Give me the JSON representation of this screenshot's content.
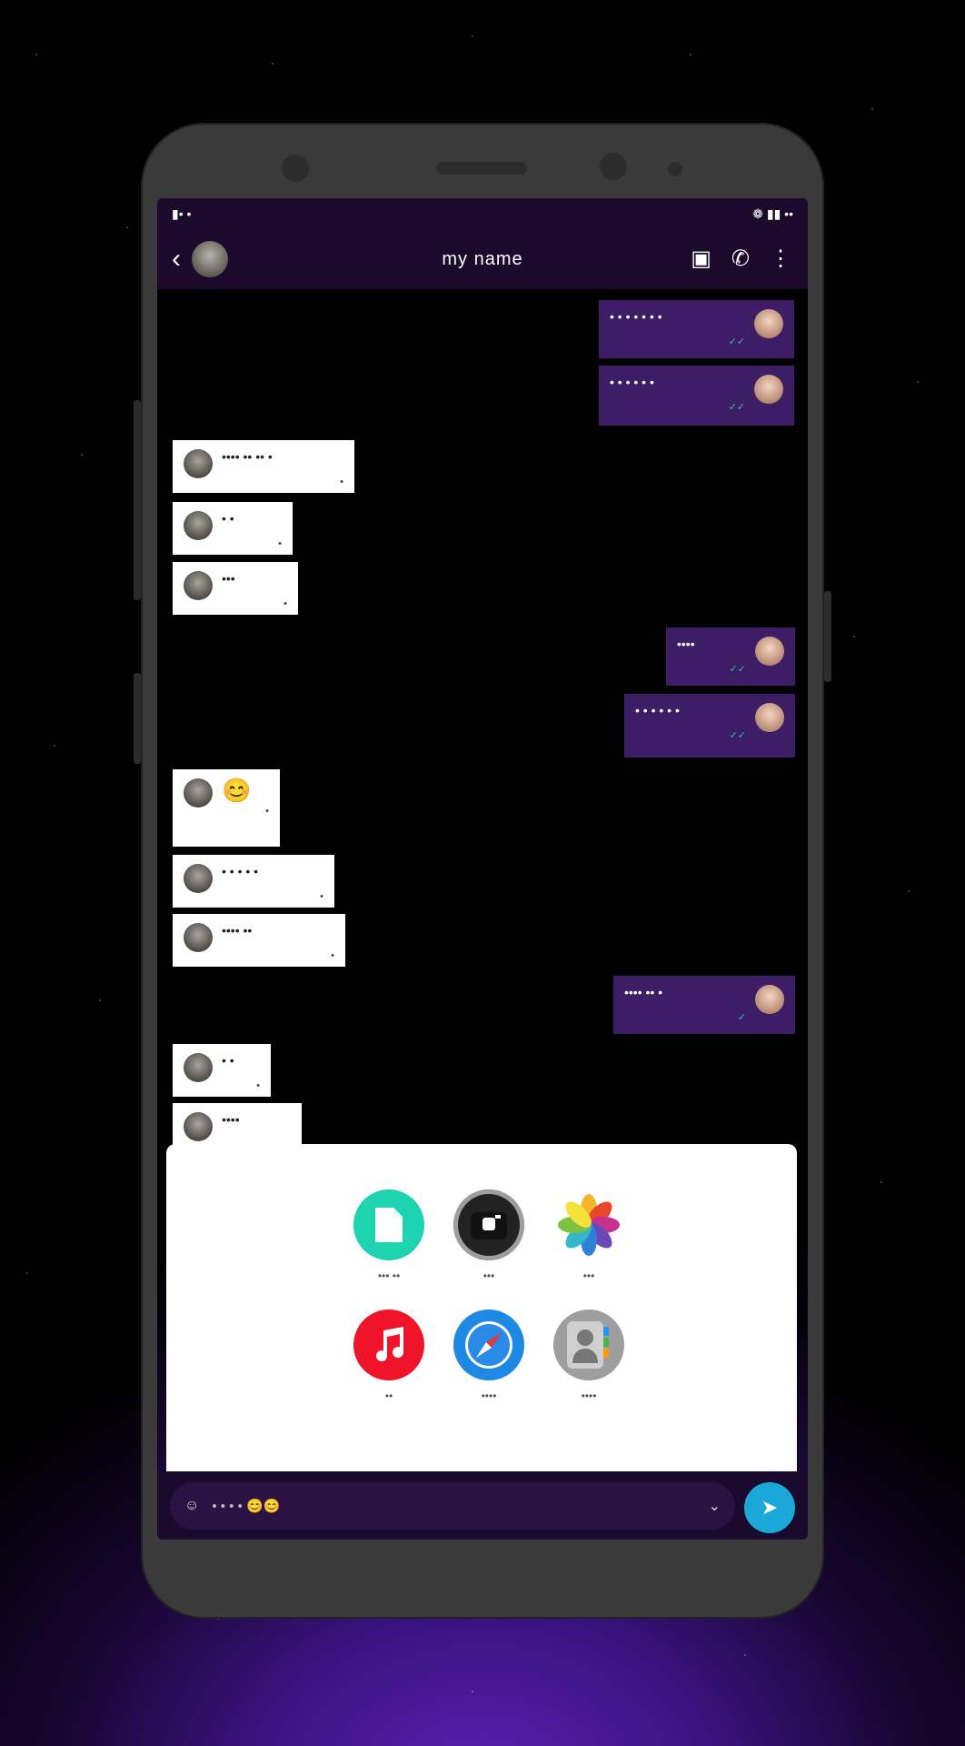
{
  "status_bar": {
    "left": "▮• •",
    "right": "❁ ▮▮ ••"
  },
  "header": {
    "title": "my name",
    "back_icon": "‹"
  },
  "messages": [
    {
      "dir": "out",
      "text": "• • • • • • •",
      "meta": "✓✓"
    },
    {
      "dir": "out",
      "text": "• • •   • • •",
      "meta": "✓✓"
    },
    {
      "dir": "in",
      "text": "•••• •• •• •",
      "meta": "•"
    },
    {
      "dir": "in",
      "text": "• •",
      "meta": "•"
    },
    {
      "dir": "in",
      "text": "•••",
      "meta": "•"
    },
    {
      "dir": "out",
      "text": "••••",
      "meta": "✓✓"
    },
    {
      "dir": "out",
      "text": "• • • • • •",
      "meta": "✓✓"
    },
    {
      "dir": "in",
      "text": "😊",
      "meta": "•"
    },
    {
      "dir": "in",
      "text": "• • • • •",
      "meta": "•"
    },
    {
      "dir": "in",
      "text": "•••• ••",
      "meta": "•"
    },
    {
      "dir": "out",
      "text": "•••• •• •",
      "meta": "✓"
    },
    {
      "dir": "in",
      "text": "• •",
      "meta": "•"
    },
    {
      "dir": "in",
      "text": "••••",
      "meta": ""
    }
  ],
  "share_sheet": {
    "apps": [
      {
        "name": "file-app",
        "label": "••• ••",
        "color": "#1dd3b0",
        "icon": "document"
      },
      {
        "name": "camera-app",
        "label": "•••",
        "color": "#222222",
        "icon": "camera"
      },
      {
        "name": "photos-app",
        "label": "•••",
        "color": "#ffffff",
        "icon": "pinwheel"
      },
      {
        "name": "music-app",
        "label": "••",
        "color": "#f0142a",
        "icon": "music-note"
      },
      {
        "name": "safari-app",
        "label": "••••",
        "color": "#1e88e5",
        "icon": "compass"
      },
      {
        "name": "contacts-app",
        "label": "••••",
        "color": "#9e9e9e",
        "icon": "contact"
      }
    ]
  },
  "composer": {
    "placeholder": "• • • •",
    "emoji_hint": "😊😊",
    "expand_icon": "⌄",
    "send_icon": "➤"
  }
}
